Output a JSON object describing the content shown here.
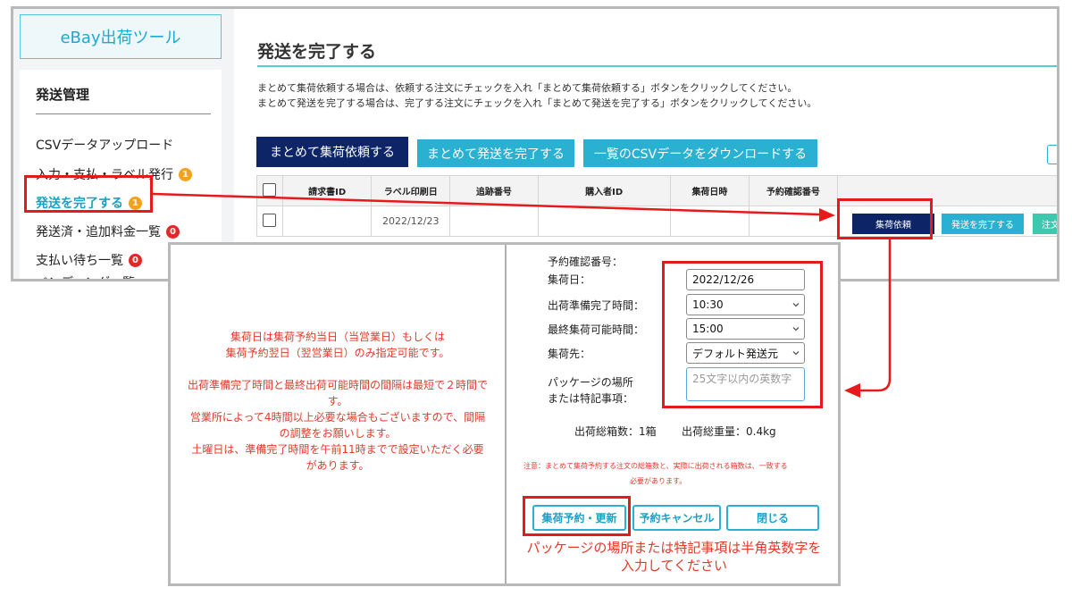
{
  "app": {
    "logo": "eBay出荷ツール"
  },
  "sidebar": {
    "heading": "発送管理",
    "items": [
      {
        "label": "CSVデータアップロード",
        "badge": ""
      },
      {
        "label": "入力・支払・ラベル発行",
        "badge": "1"
      },
      {
        "label": "発送を完了する",
        "badge": "1"
      },
      {
        "label": "発送済・追加料金一覧",
        "badge": "0"
      },
      {
        "label": "支払い待ち一覧",
        "badge": "0"
      },
      {
        "label": "ペンディング一覧",
        "badge": ""
      }
    ]
  },
  "main": {
    "title": "発送を完了する",
    "instructions": [
      "まとめて集荷依頼する場合は、依頼する注文にチェックを入れ「まとめて集荷依頼する」ボタンをクリックしてください。",
      "まとめて発送を完了する場合は、完了する注文にチェックを入れ「まとめて発送を完了する」ボタンをクリックしてください。"
    ],
    "buttons": {
      "bulk_pickup": "まとめて集荷依頼する",
      "bulk_complete": "まとめて発送を完了する",
      "download_csv": "一覧のCSVデータをダウンロードする"
    },
    "table": {
      "headers": [
        "請求書ID",
        "ラベル印刷日",
        "追跡番号",
        "購入者ID",
        "集荷日時",
        "予約確認番号"
      ],
      "rows": [
        {
          "invoice_id": "",
          "label_date": "2022/12/23",
          "tracking": "",
          "buyer_id": "",
          "pickup_datetime": "",
          "confirm_no": ""
        }
      ]
    },
    "row_actions": {
      "pickup": "集荷依頼",
      "complete": "発送を完了する",
      "order": "注文詳"
    }
  },
  "modal": {
    "notes": [
      "集荷日は集荷予約当日（当営業日）もしくは",
      "集荷予約翌日（翌営業日）のみ指定可能です。",
      "出荷準備完了時間と最終出荷可能時間の間隔は最短で２時間で",
      "す。",
      "営業所によって4時間以上必要な場合もございますので、間隔",
      "の調整をお願いします。",
      "土曜日は、準備完了時間を午前11時までで設定いただく必要",
      "があります。"
    ],
    "form": {
      "confirm_no_label": "予約確認番号：",
      "pickup_date_label": "集荷日：",
      "pickup_date_value": "2022/12/26",
      "ready_time_label": "出荷準備完了時間：",
      "ready_time_value": "10:30",
      "last_time_label": "最終集荷可能時間：",
      "last_time_value": "15:00",
      "destination_label": "集荷先：",
      "destination_value": "デフォルト発送元",
      "package_label_1": "パッケージの場所",
      "package_label_2": "または特記事項：",
      "package_placeholder": "25文字以内の英数字"
    },
    "totals": {
      "boxes": "出荷総箱数：1箱",
      "weight": "出荷総重量：0.4kg"
    },
    "caution_1": "注意：まとめて集荷予約する注文の総箱数と、実際に出荷される箱数は、一致する",
    "caution_2": "必要があります。",
    "buttons": {
      "reserve": "集荷予約・更新",
      "cancel": "予約キャンセル",
      "close": "閉じる"
    },
    "annotation_1": "パッケージの場所または特記事項は半角英数字を",
    "annotation_2": "入力してください"
  },
  "colors": {
    "navy": "#0d2566",
    "teal": "#2ab1d1",
    "highlight_red": "#e8191a",
    "accent_blue": "#1da9cf"
  }
}
